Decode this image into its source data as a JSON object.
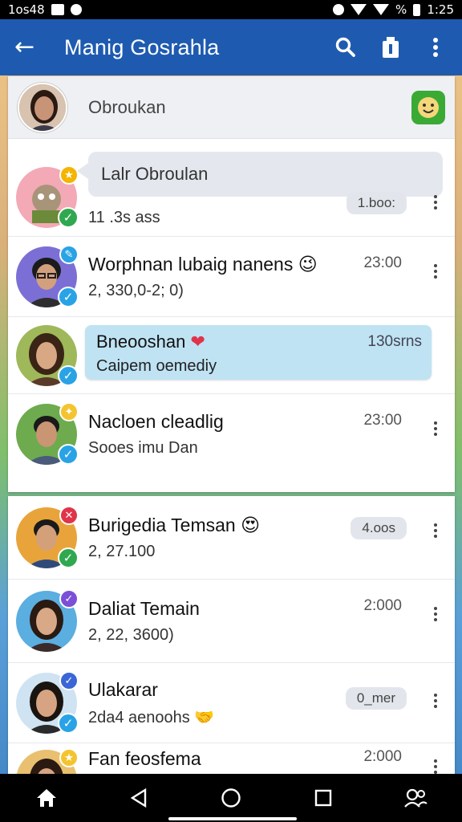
{
  "status_bar": {
    "left_text": "1os48",
    "time": "1:25",
    "battery_text": "%"
  },
  "app_bar": {
    "back": "←",
    "title": "Manig Gosrahla"
  },
  "search": {
    "name": "Obroukan"
  },
  "rows": [
    {
      "bubble": "Lalr Obroulan",
      "sub": "11 .3s ass",
      "pill": "1.boo:"
    },
    {
      "title": "Worphnan lubaig nanens",
      "emoji": "😉",
      "sub": "2, 330,0-2; 0)",
      "time": "23:00"
    },
    {
      "title": "Bneooshan",
      "emoji": "❤",
      "sub": "Caipem oemediy",
      "time": "130srns"
    },
    {
      "title": "Nacloen cleadlig",
      "sub": "Sooes imu Dan",
      "time": "23:00"
    },
    {
      "title": "Burigedia Temsan",
      "emoji": "😍",
      "sub": "2, 27.100",
      "pill": "4.oos"
    },
    {
      "title": "Daliat Temain",
      "sub": "2, 22, 3600)",
      "time": "2:000"
    },
    {
      "title": "Ulakarar",
      "sub": "2da4 aenoohs",
      "emoji": "🤝",
      "pill": "0_mer"
    },
    {
      "title": "Fan feosfema",
      "time": "2:000"
    }
  ],
  "colors": {
    "app_bar": "#1e5bb0",
    "green": "#2fa84f",
    "blue_badge": "#29a3e6",
    "bubble_blue": "#bfe3f3"
  }
}
